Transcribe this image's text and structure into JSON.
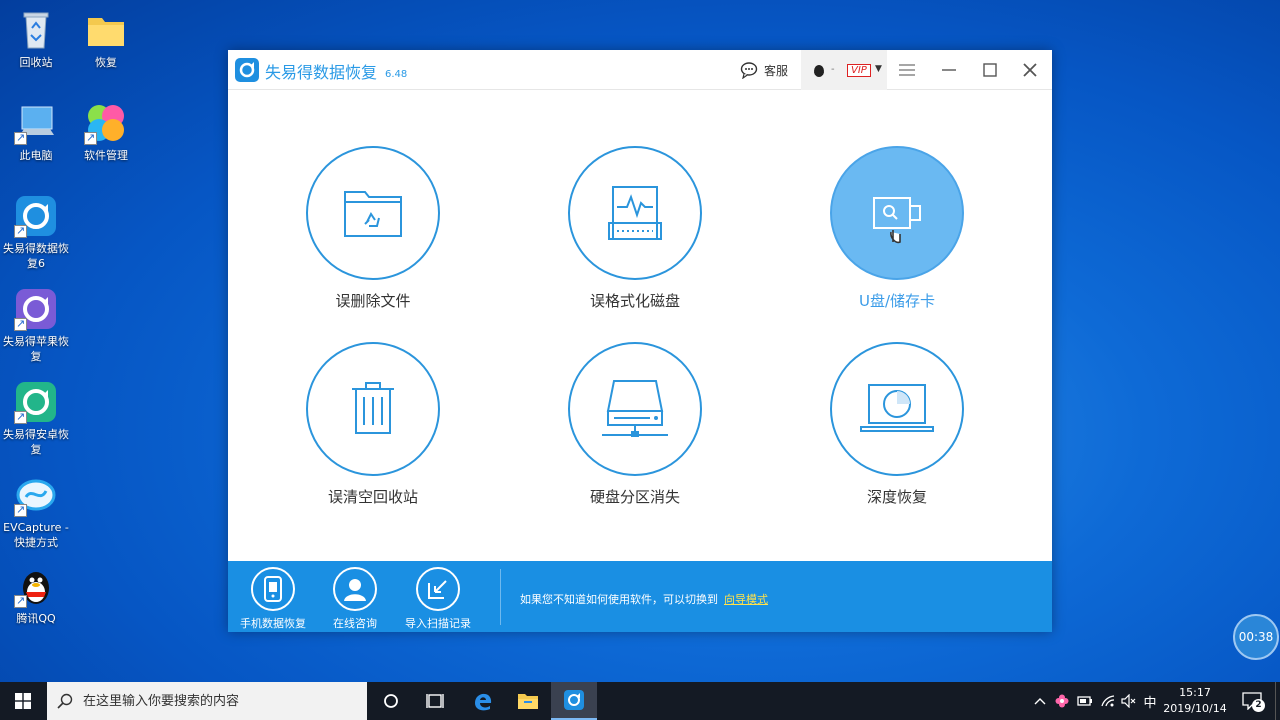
{
  "desktop": {
    "icons": [
      {
        "label": "回收站"
      },
      {
        "label": "恢复"
      },
      {
        "label": "此电脑"
      },
      {
        "label": "软件管理"
      },
      {
        "label": "失易得数据恢复6"
      },
      {
        "label": "失易得苹果恢复"
      },
      {
        "label": "失易得安卓恢复"
      },
      {
        "label": "EVCapture - 快捷方式"
      },
      {
        "label": "腾讯QQ"
      }
    ]
  },
  "app": {
    "title": "失易得数据恢复",
    "version": "6.48",
    "header": {
      "service_label": "客服",
      "user_dash": "-",
      "vip_label": "VIP"
    },
    "tiles": [
      {
        "label": "误删除文件",
        "icon": "folder-recycle-icon"
      },
      {
        "label": "误格式化磁盘",
        "icon": "disk-pulse-icon"
      },
      {
        "label": "U盘/储存卡",
        "icon": "usb-search-icon",
        "active": true
      },
      {
        "label": "误清空回收站",
        "icon": "trash-icon"
      },
      {
        "label": "硬盘分区消失",
        "icon": "network-drive-icon"
      },
      {
        "label": "深度恢复",
        "icon": "laptop-scan-icon"
      }
    ],
    "footer": {
      "items": [
        {
          "label": "手机数据恢复",
          "icon": "phone-icon"
        },
        {
          "label": "在线咨询",
          "icon": "person-icon"
        },
        {
          "label": "导入扫描记录",
          "icon": "import-icon"
        }
      ],
      "hint_text": "如果您不知道如何使用软件，可以切换到",
      "hint_link": "向导模式"
    }
  },
  "timer": "00:38",
  "taskbar": {
    "search_placeholder": "在这里输入你要搜索的内容",
    "ime_label": "中",
    "time": "15:17",
    "date": "2019/10/14",
    "notification_count": "2"
  },
  "colors": {
    "accent": "#2b95dc",
    "footer_bg": "#1a8fe3",
    "active_tile": "#6ab9f2",
    "link": "#ffe24a"
  }
}
